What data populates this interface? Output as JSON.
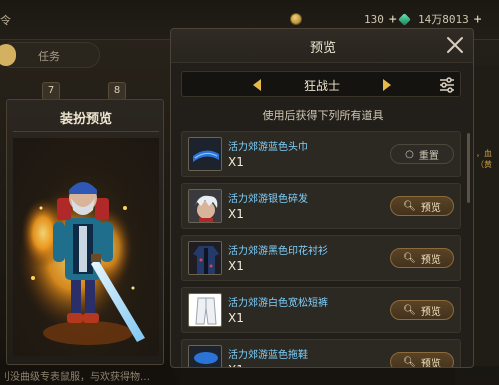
{
  "background": {
    "top_left_text": "令",
    "currency_1": {
      "value": "130",
      "icon": "coin-icon",
      "color": "#c8a24a"
    },
    "currency_2": {
      "value": "14万8013",
      "icon": "gem-icon",
      "color": "#2fb37a"
    },
    "tab_task_label": "任务",
    "badges": [
      "7",
      "8"
    ],
    "right_gold_text": "，血（黄",
    "bottom_text": "刂没曲级专表鼠服，与欢获得物…"
  },
  "outfit_panel": {
    "title": "装扮预览"
  },
  "modal": {
    "title": "预览",
    "close_icon": "close-icon",
    "class_selector": {
      "prev_icon": "chevron-left-icon",
      "next_icon": "chevron-right-icon",
      "class_name": "狂战士",
      "filter_icon": "sliders-icon"
    },
    "subtitle": "使用后获得下列所有道具",
    "items": [
      {
        "name": "活力郊游蓝色头巾",
        "qty": "X1",
        "button": "重置",
        "button_type": "reset",
        "icon": "headband-icon"
      },
      {
        "name": "活力郊游银色碎发",
        "qty": "X1",
        "button": "预览",
        "button_type": "preview",
        "icon": "hair-icon"
      },
      {
        "name": "活力郊游黑色印花衬衫",
        "qty": "X1",
        "button": "预览",
        "button_type": "preview",
        "icon": "shirt-icon"
      },
      {
        "name": "活力郊游白色宽松短裤",
        "qty": "X1",
        "button": "预览",
        "button_type": "preview",
        "icon": "shorts-icon"
      },
      {
        "name": "活力郊游蓝色拖鞋",
        "qty": "X1",
        "button": "预览",
        "button_type": "preview",
        "icon": "slippers-icon"
      }
    ]
  },
  "colors": {
    "item_name": "#7fd2ff",
    "accent_gold": "#d3b160",
    "button_preview": "#5a4426"
  }
}
